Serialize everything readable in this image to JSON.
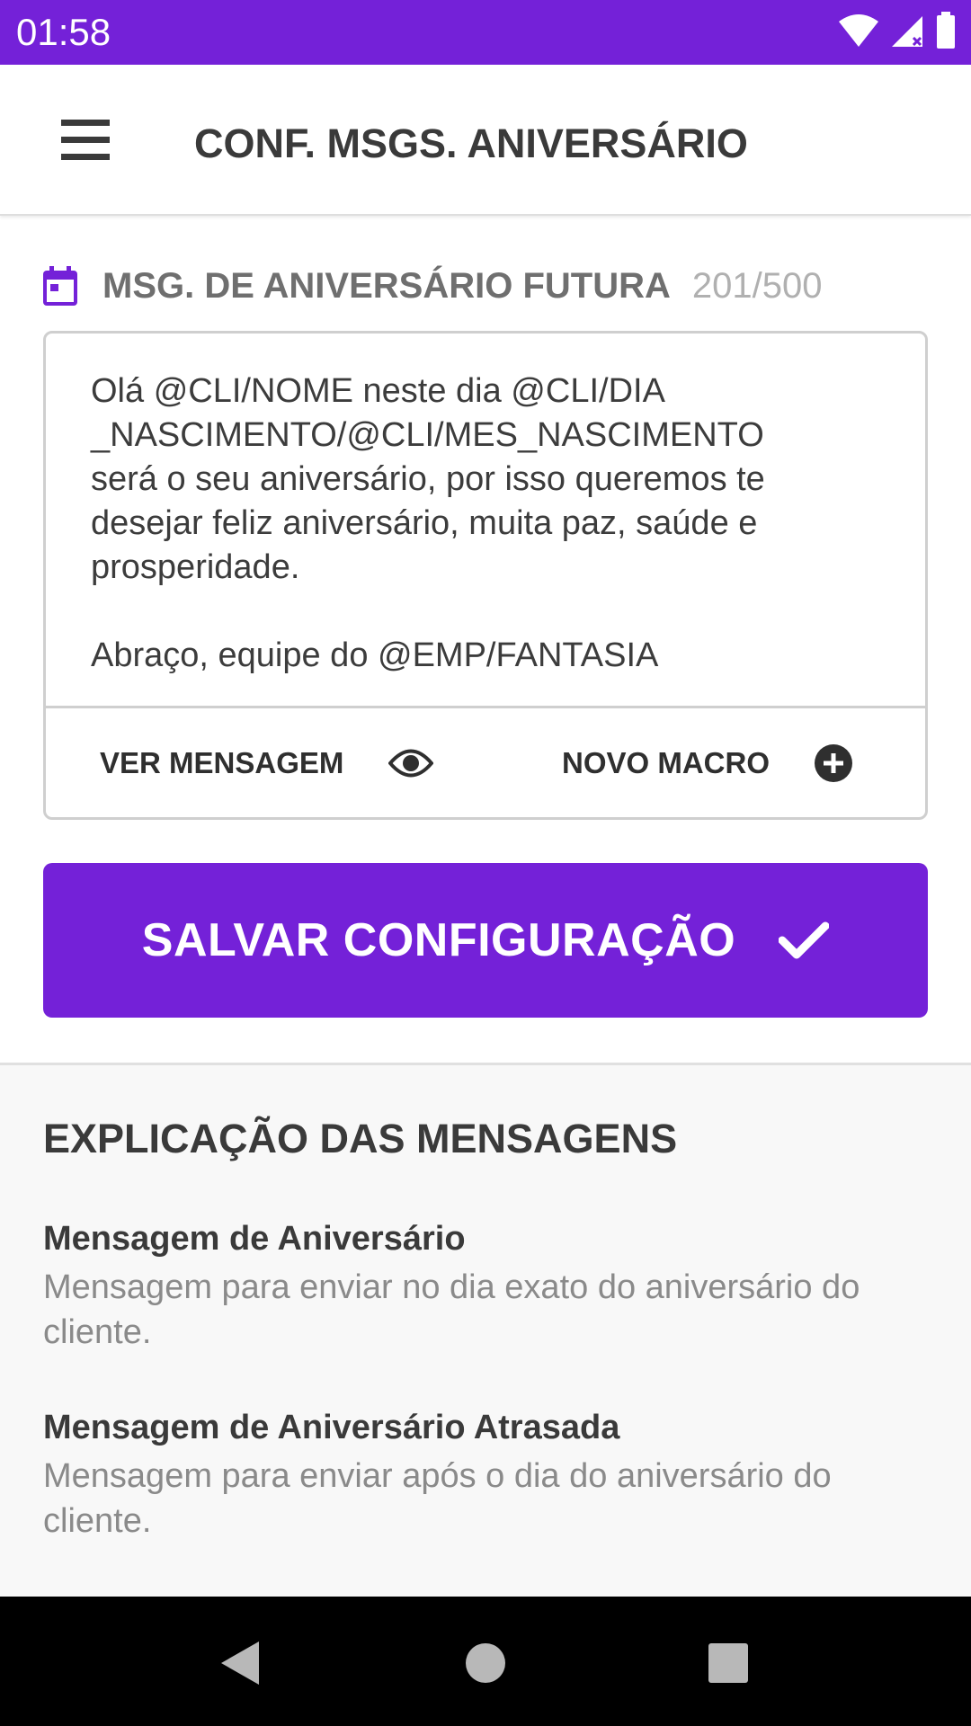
{
  "status_bar": {
    "time": "01:58"
  },
  "app_bar": {
    "title": "CONF. MSGS. ANIVERSÁRIO",
    "menu_icon": "hamburger-menu-icon"
  },
  "section": {
    "icon": "calendar-icon",
    "label": "MSG. DE ANIVERSÁRIO FUTURA",
    "count": "201/500"
  },
  "editor": {
    "text": "Olá @CLI/NOME neste dia @CLI/DIA\n_NASCIMENTO/@CLI/MES_NASCIMENTO\nserá o seu aniversário, por isso queremos te\ndesejar feliz aniversário, muita paz, saúde e\nprosperidade.\n\nAbraço, equipe do @EMP/FANTASIA",
    "view_label": "VER MENSAGEM",
    "view_icon": "eye-icon",
    "macro_label": "NOVO MACRO",
    "macro_icon": "add-circle-icon"
  },
  "save_button": {
    "label": "SALVAR CONFIGURAÇÃO",
    "icon": "check-icon"
  },
  "explanation": {
    "title": "EXPLICAÇÃO DAS MENSAGENS",
    "items": [
      {
        "heading": "Mensagem de Aniversário",
        "description": "Mensagem para enviar no dia exato do aniversário do cliente."
      },
      {
        "heading": "Mensagem de Aniversário Atrasada",
        "description": "Mensagem para enviar após o dia do aniversário do cliente."
      }
    ]
  },
  "colors": {
    "primary": "#7421d8",
    "text_dark": "#3a3a3a",
    "text_muted": "#8a8a8a"
  }
}
